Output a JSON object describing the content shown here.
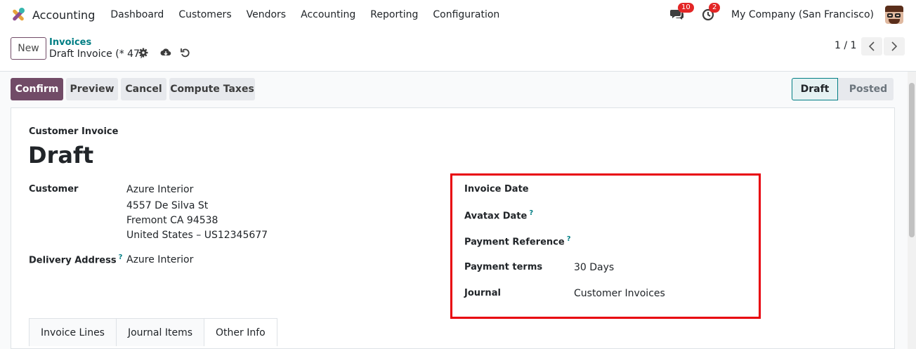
{
  "navbar": {
    "app_name": "Accounting",
    "menu": [
      "Dashboard",
      "Customers",
      "Vendors",
      "Accounting",
      "Reporting",
      "Configuration"
    ],
    "messages_count": "10",
    "activities_count": "2",
    "company": "My Company (San Francisco)"
  },
  "control": {
    "new_label": "New",
    "breadcrumb": "Invoices",
    "record_title": "Draft Invoice (* 47)",
    "pager": "1 / 1"
  },
  "actions": {
    "confirm": "Confirm",
    "preview": "Preview",
    "cancel": "Cancel",
    "compute_taxes": "Compute Taxes"
  },
  "status": {
    "draft": "Draft",
    "posted": "Posted"
  },
  "form": {
    "move_type": "Customer Invoice",
    "state": "Draft",
    "customer_label": "Customer",
    "customer_lines": [
      "Azure Interior",
      "4557 De Silva St",
      "Fremont CA 94538",
      "United States – US12345677"
    ],
    "delivery_label": "Delivery Address",
    "delivery_value": "Azure Interior",
    "invoice_date_label": "Invoice Date",
    "avatax_date_label": "Avatax Date",
    "payment_reference_label": "Payment Reference",
    "payment_terms_label": "Payment terms",
    "payment_terms_value": "30 Days",
    "journal_label": "Journal",
    "journal_value": "Customer Invoices",
    "help_mark": "?"
  },
  "tabs": [
    "Invoice Lines",
    "Journal Items",
    "Other Info"
  ],
  "colors": {
    "primary": "#714B67",
    "accent": "#017E84",
    "highlight": "#E8000B",
    "badge": "#E32626"
  }
}
